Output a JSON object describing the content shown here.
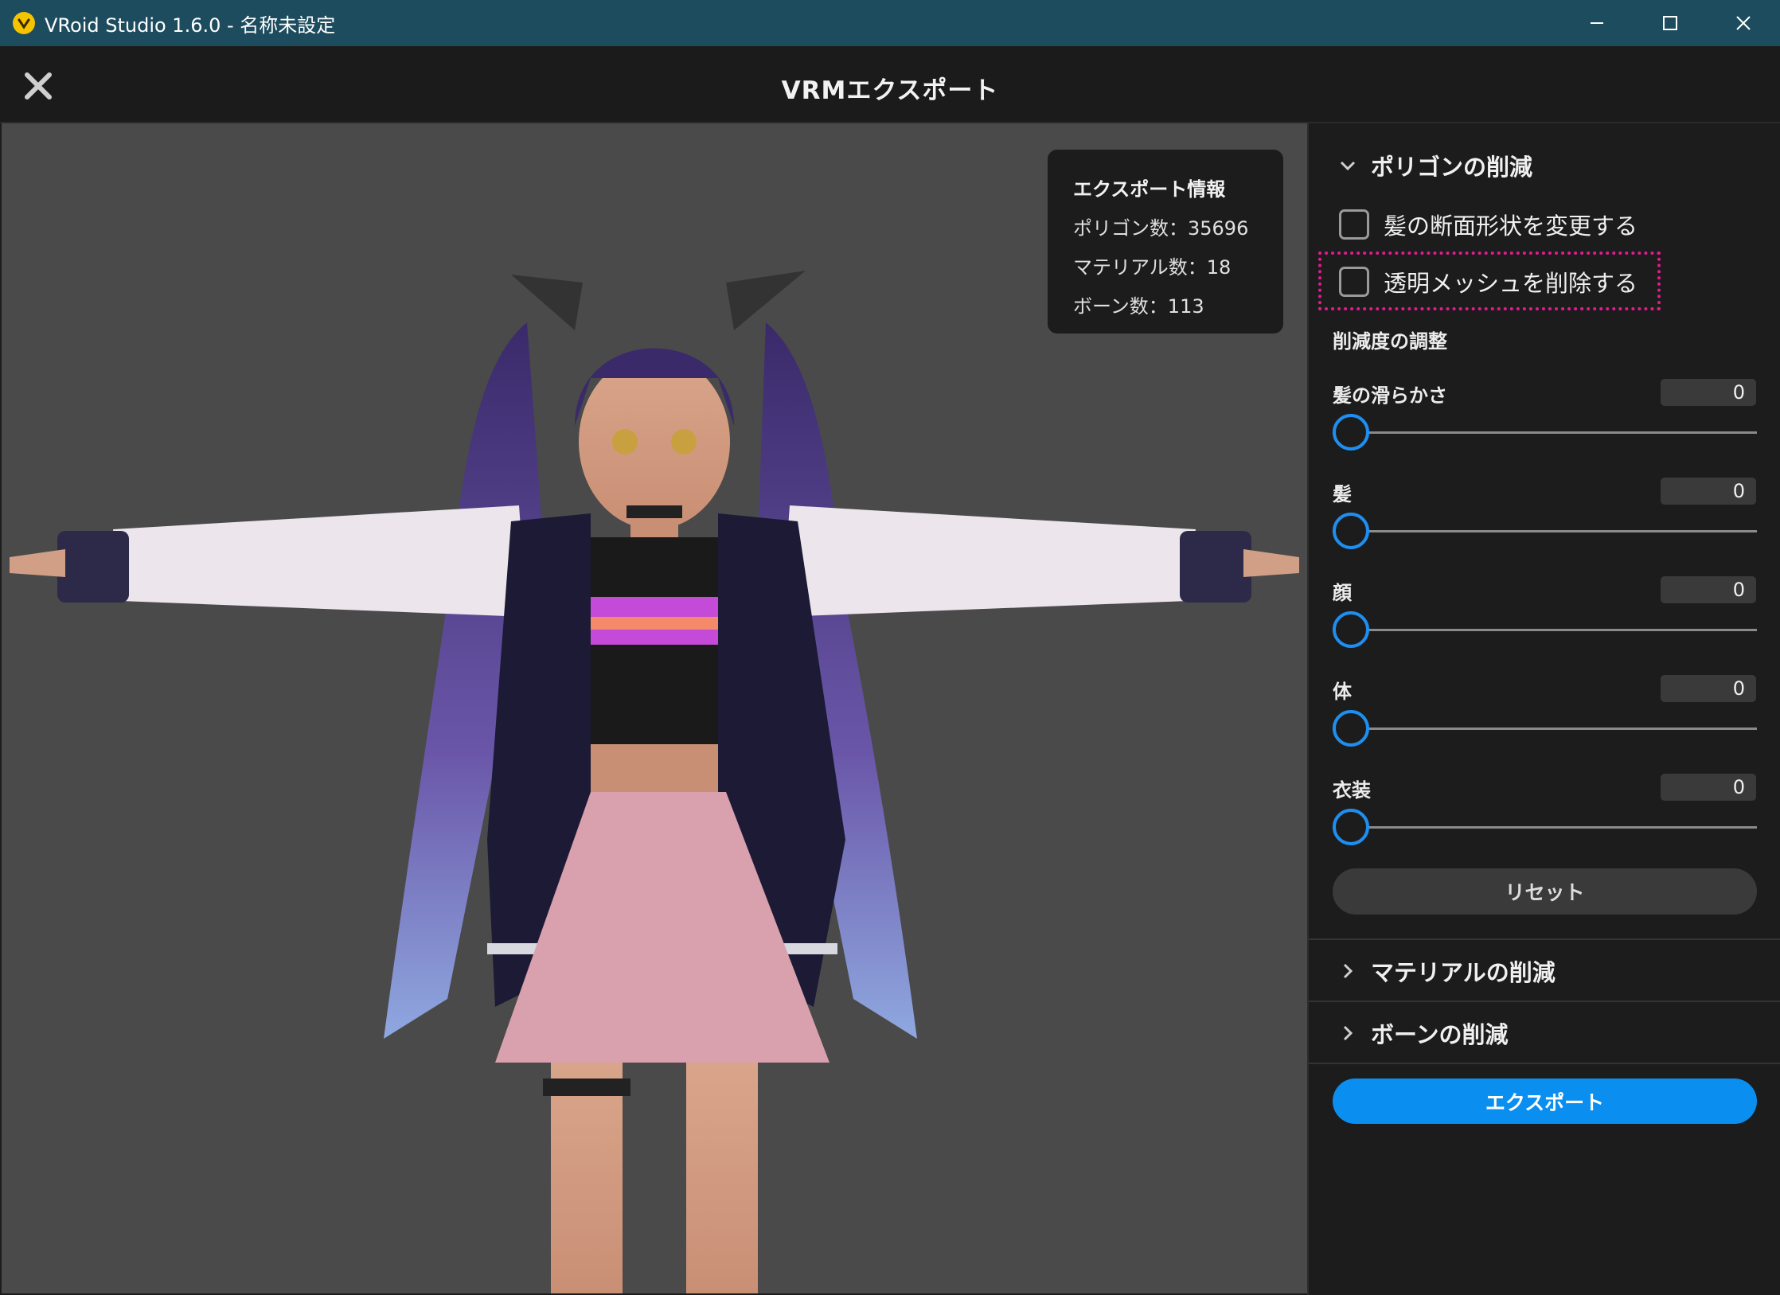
{
  "window": {
    "title": "VRoid Studio 1.6.0 - 名称未設定",
    "controls": [
      "minimize-icon",
      "maximize-icon",
      "close-icon"
    ]
  },
  "header": {
    "title": "VRMエクスポート",
    "close_icon": "close-x-icon"
  },
  "export_info": {
    "title": "エクスポート情報",
    "polygons": "ポリゴン数：35696",
    "materials": "マテリアル数：18",
    "bones": "ボーン数：113"
  },
  "panel": {
    "polygon_section": {
      "title": "ポリゴンの削減",
      "expanded": true,
      "checkboxes": [
        {
          "label": "髪の断面形状を変更する",
          "checked": false
        },
        {
          "label": "透明メッシュを削除する",
          "checked": false
        }
      ],
      "adjust_title": "削減度の調整",
      "sliders": [
        {
          "label": "髪の滑らかさ",
          "value": "0"
        },
        {
          "label": "髪",
          "value": "0"
        },
        {
          "label": "顔",
          "value": "0"
        },
        {
          "label": "体",
          "value": "0"
        },
        {
          "label": "衣装",
          "value": "0"
        }
      ],
      "reset_label": "リセット"
    },
    "material_section": {
      "title": "マテリアルの削減",
      "expanded": false
    },
    "bone_section": {
      "title": "ボーンの削減",
      "expanded": false
    },
    "export_label": "エクスポート"
  },
  "colors": {
    "titlebar": "#1d4c5f",
    "accent": "#0a8ff0",
    "highlight": "#e31b8f",
    "viewport_bg": "#4a4a4a"
  }
}
